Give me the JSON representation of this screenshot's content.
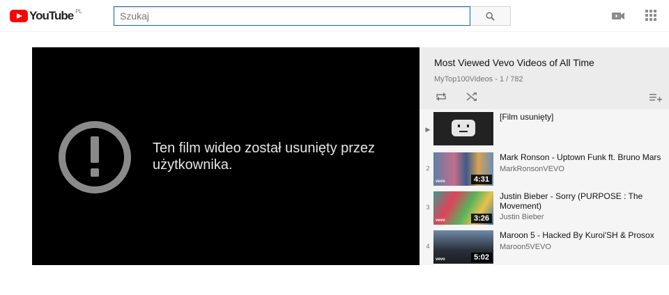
{
  "header": {
    "logo_text": "YouTube",
    "country_code": "PL",
    "search_placeholder": "Szukaj",
    "search_value": "",
    "icons": [
      "search-icon",
      "video-camera-icon",
      "apps-grid-icon"
    ],
    "brand_color": "#ff0000"
  },
  "player": {
    "message": "Ten film wideo został usunięty przez użytkownika.",
    "icon": "alert-circle-icon"
  },
  "playlist": {
    "title": "Most Viewed Vevo Videos of All Time",
    "subtitle": "MyTop100Videos - 1 / 782",
    "controls": [
      "loop-icon",
      "shuffle-icon",
      "add-to-queue-icon"
    ],
    "items": [
      {
        "index": "▶",
        "title": "[Film usunięty]",
        "channel": "",
        "duration": ""
      },
      {
        "index": "2",
        "title": "Mark Ronson - Uptown Funk ft. Bruno Mars",
        "channel": "MarkRonsonVEVO",
        "duration": "4:31"
      },
      {
        "index": "3",
        "title": "Justin Bieber - Sorry (PURPOSE : The Movement)",
        "channel": "Justin Bieber",
        "duration": "3:26"
      },
      {
        "index": "4",
        "title": "Maroon 5 - Hacked By Kuroi'SH & Prosox",
        "channel": "Maroon5VEVO",
        "duration": "5:02"
      }
    ]
  }
}
